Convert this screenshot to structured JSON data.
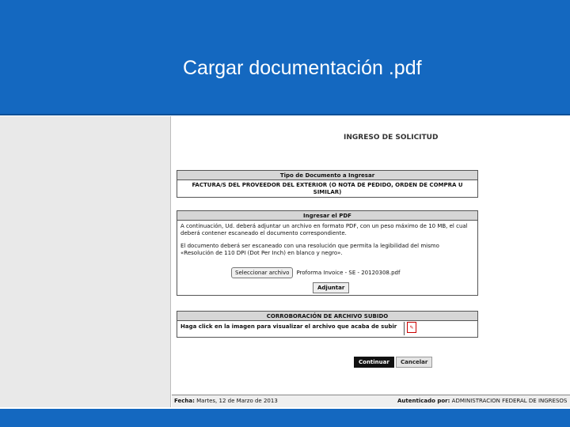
{
  "slide": {
    "title": "Cargar documentación .pdf"
  },
  "page": {
    "heading": "INGRESO DE SOLICITUD"
  },
  "document_type": {
    "header": "Tipo de Documento a Ingresar",
    "value": "FACTURA/S DEL PROVEEDOR DEL EXTERIOR (O NOTA DE PEDIDO, ORDEN DE COMPRA U SIMILAR)"
  },
  "upload": {
    "header": "Ingresar el PDF",
    "instruction_1": "A continuación, Ud. deberá adjuntar un archivo en formato PDF, con un peso máximo de 10 MB, el cual deberá contener escaneado el documento correspondiente.",
    "instruction_2": "El documento deberá ser escaneado con una resolución que permita la legibilidad del mismo «Resolución de 110 DPI (Dot Per Inch) en blanco y negro».",
    "choose_file_label": "Seleccionar archivo",
    "file_name": "Proforma Invoice - SE - 20120308.pdf",
    "attach_label": "Adjuntar"
  },
  "confirmation": {
    "header": "CORROBORACIÓN DE ARCHIVO SUBIDO",
    "text": "Haga click en la imagen para visualizar el archivo que acaba de subir",
    "icon": "pdf-file-icon"
  },
  "actions": {
    "continue_label": "Continuar",
    "cancel_label": "Cancelar"
  },
  "status": {
    "date_label": "Fecha:",
    "date_value": "Martes, 12 de Marzo de 2013",
    "auth_label": "Autenticado por:",
    "auth_value": "ADMINISTRACION FEDERAL DE INGRESOS"
  },
  "colors": {
    "slide_blue": "#1468c0",
    "panel_header": "#d6d6d6",
    "continue_button": "#111111"
  }
}
